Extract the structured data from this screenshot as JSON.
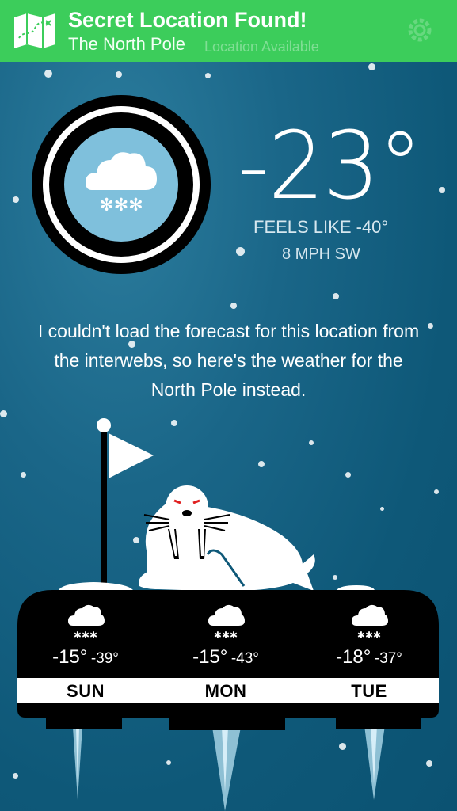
{
  "notification": {
    "title": "Secret Location Found!",
    "subtitle": "The North Pole",
    "behind_text": "Location Available",
    "icon": "map-icon"
  },
  "current": {
    "temperature": "-23°",
    "feels_like": "FEELS LIKE -40°",
    "wind": "8 MPH SW",
    "condition_icon": "snow-cloud-icon"
  },
  "message": "I couldn't load the forecast for this location from the interwebs, so here's the weather for the North Pole instead.",
  "forecast": [
    {
      "day": "SUN",
      "high": "-15°",
      "low": "-39°",
      "icon": "snow-cloud-icon"
    },
    {
      "day": "MON",
      "high": "-15°",
      "low": "-43°",
      "icon": "snow-cloud-icon"
    },
    {
      "day": "TUE",
      "high": "-18°",
      "low": "-37°",
      "icon": "snow-cloud-icon"
    }
  ],
  "colors": {
    "background": "#0e5878",
    "banner": "#3ccd5b",
    "condition_circle": "#7fc0dc",
    "ice_platform": "#000000"
  }
}
